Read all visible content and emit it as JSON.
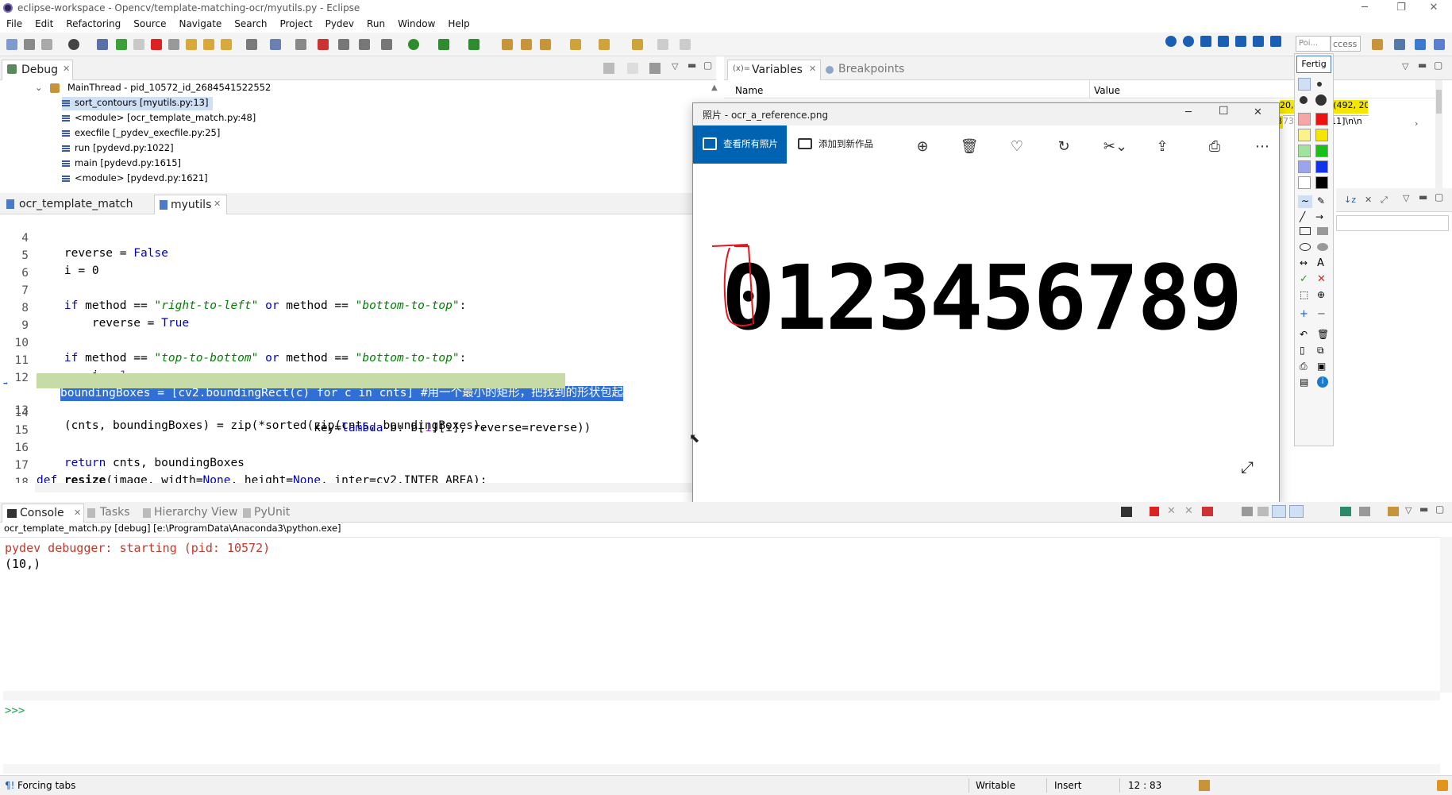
{
  "window": {
    "title": "eclipse-workspace - Opencv/template-matching-ocr/myutils.py - Eclipse",
    "minimize": "─",
    "maximize": "❐",
    "close": "✕"
  },
  "menubar": [
    "File",
    "Edit",
    "Refactoring",
    "Source",
    "Navigate",
    "Search",
    "Project",
    "Pydev",
    "Run",
    "Window",
    "Help"
  ],
  "debug": {
    "tab_label": "Debug",
    "thread": "MainThread - pid_10572_id_2684541522552",
    "frames": [
      "sort_contours [myutils.py:13]",
      "<module> [ocr_template_match.py:48]",
      "execfile [_pydev_execfile.py:25]",
      "run [pydevd.py:1022]",
      "main [pydevd.py:1615]",
      "<module> [pydevd.py:1621]"
    ]
  },
  "variables": {
    "tab_variables": "Variables",
    "tab_breakpoints": "Breakpoints",
    "col_name": "Name",
    "col_value": "Value",
    "value_fragment_1": "20, 53, 85), (492, 20, 53,",
    "value_fragment_2": "[[732  211]\\n\\n",
    "value_fragment_3": "8",
    "value_fragment_4": "73"
  },
  "editor": {
    "tabs": [
      "ocr_template_match",
      "myutils"
    ],
    "lines": [
      {
        "n": "4",
        "text": "    reverse = False"
      },
      {
        "n": "5",
        "text": "    i = 0"
      },
      {
        "n": "6",
        "text": ""
      },
      {
        "n": "7",
        "text": "    if method == \"right-to-left\" or method == \"bottom-to-top\":"
      },
      {
        "n": "8",
        "text": "        reverse = True"
      },
      {
        "n": "9",
        "text": ""
      },
      {
        "n": "10",
        "text": "    if method == \"top-to-bottom\" or method == \"bottom-to-top\":"
      },
      {
        "n": "11",
        "text": "        i = 1"
      },
      {
        "n": "12",
        "text": "    boundingBoxes = [cv2.boundingRect(c) for c in cnts] #用一个最小的矩形，把找到的形状包起"
      },
      {
        "n": "13",
        "text": "    (cnts, boundingBoxes) = zip(*sorted(zip(cnts, boundingBoxes),"
      },
      {
        "n": "14",
        "text": "                                        key=lambda b: b[1][i], reverse=reverse))"
      },
      {
        "n": "15",
        "text": ""
      },
      {
        "n": "16",
        "text": "    return cnts, boundingBoxes"
      },
      {
        "n": "17",
        "text": "def resize(image, width=None, height=None, inter=cv2.INTER_AREA):"
      },
      {
        "n": "18",
        "text": "    dim = None"
      }
    ]
  },
  "photo": {
    "title": "照片 - ocr_a_reference.png",
    "view_all": "查看所有照片",
    "add_to": "添加到新作品",
    "digits": "0123456789",
    "expand_icon": "⤢"
  },
  "palette": {
    "top_field": "Poi...",
    "ccess": "ccess",
    "fertig": "Fertig"
  },
  "console": {
    "tabs": [
      "Console",
      "Tasks",
      "Hierarchy View",
      "PyUnit"
    ],
    "header": "ocr_template_match.py [debug] [e:\\ProgramData\\Anaconda3\\python.exe]",
    "lines": [
      "pydev debugger: starting (pid: 10572)",
      "(10,)"
    ],
    "prompt": ">>>"
  },
  "status": {
    "left": "Forcing tabs",
    "writable": "Writable",
    "insert": "Insert",
    "position": "12 : 83"
  },
  "colors": {
    "selection": "#2f6fd6",
    "debug_line": "#c6dba6",
    "keyword": "#0000c8",
    "string": "#008000",
    "console_red": "#c0392b",
    "photos_blue": "#0063b1",
    "yellow_highlight": "#f5e600"
  }
}
